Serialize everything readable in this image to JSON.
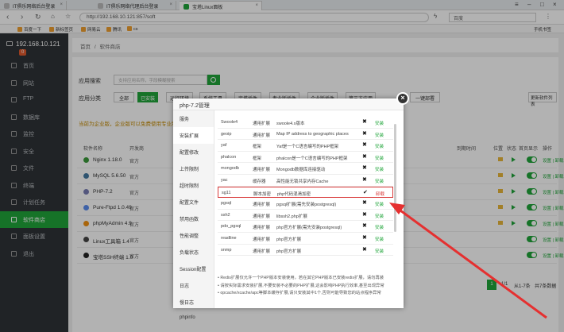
{
  "browser": {
    "tabs": [
      {
        "label": "IT俱乐网络后台登录"
      },
      {
        "label": "IT俱乐网络代理后台登录"
      },
      {
        "label": "宝塔Linux面板"
      }
    ],
    "url": "http://192.168.10.121:857/soft",
    "search_placeholder": "百度",
    "bookmarks": [
      "百度一下",
      "新标签页",
      "网易云",
      "腾讯",
      "cs"
    ],
    "bookmarks_right": "手机书签"
  },
  "sidebar": {
    "host": "192.168.10.121",
    "badge": "0",
    "items": [
      {
        "label": "首页"
      },
      {
        "label": "网站"
      },
      {
        "label": "FTP"
      },
      {
        "label": "数据库"
      },
      {
        "label": "监控"
      },
      {
        "label": "安全"
      },
      {
        "label": "文件"
      },
      {
        "label": "终端"
      },
      {
        "label": "计划任务"
      },
      {
        "label": "软件商店"
      },
      {
        "label": "面板设置"
      },
      {
        "label": "退出"
      }
    ]
  },
  "breadcrumb": {
    "home": "首页",
    "sep": "/",
    "current": "软件商店"
  },
  "store": {
    "search_label": "应用搜索",
    "search_placeholder": "支持应用名称，字段模糊搜索",
    "category_label": "应用分类",
    "categories": [
      "全部",
      "已安装",
      "运行环境",
      "系统工具",
      "宝塔插件",
      "专业版插件",
      "企业版插件",
      "第三方应用",
      "一键部署"
    ],
    "update_button": "更新软件列表",
    "notice": "当前为企业版，企业版可以免费使用专业版插件",
    "headers": [
      "软件名称",
      "开发商",
      "到期时间",
      "位置",
      "状态",
      "首页显示",
      "操作"
    ],
    "modules": [
      {
        "name": "Nginx 1.18.0",
        "dev": "官方",
        "actions": "设置 | 卸载"
      },
      {
        "name": "MySQL 5.6.50",
        "dev": "官方",
        "actions": "设置 | 卸载"
      },
      {
        "name": "PHP-7.2",
        "dev": "官方",
        "actions": "设置 | 卸载"
      },
      {
        "name": "Pure-Ftpd 1.0.49",
        "dev": "官方",
        "actions": "设置 | 卸载"
      },
      {
        "name": "phpMyAdmin 4.9",
        "dev": "官方",
        "actions": "设置 | 卸载"
      },
      {
        "name": "Linux工具箱 1.4",
        "dev": "官方",
        "actions": "设置 | 卸载"
      },
      {
        "name": "宝塔SSH终端 1.0",
        "dev": "官方",
        "actions": "设置 | 卸载"
      }
    ],
    "pager": {
      "page": "1",
      "total_pages": "1/1",
      "range": "从1-7条",
      "total": "共7条数据"
    }
  },
  "modal": {
    "title": "php-7.2管理",
    "nav": [
      "服务",
      "安装扩展",
      "配置修改",
      "上传限制",
      "超时限制",
      "配置文件",
      "禁用函数",
      "性能调整",
      "负载状态",
      "Session配置",
      "日志",
      "慢日志",
      "phpinfo"
    ],
    "active_nav": "安装扩展",
    "extensions": [
      {
        "name": "Swoole4",
        "type": "通用扩展",
        "desc": "swoole4.x版本",
        "status": "✖",
        "action": "安装"
      },
      {
        "name": "geoip",
        "type": "通用扩展",
        "desc": "Map IP address to geographic places",
        "status": "✖",
        "action": "安装"
      },
      {
        "name": "yaf",
        "type": "框架",
        "desc": "Yaf是一个C语言编写的PHP框架",
        "status": "✖",
        "action": "安装"
      },
      {
        "name": "phalcon",
        "type": "框架",
        "desc": "phalcon是一个C语言编写的PHP框架",
        "status": "✖",
        "action": "安装"
      },
      {
        "name": "mongodb",
        "type": "通用扩展",
        "desc": "Mongodb数据库连接驱动",
        "status": "✖",
        "action": "安装"
      },
      {
        "name": "yac",
        "type": "缓存器",
        "desc": "高性能无锁共享内存Cache",
        "status": "✖",
        "action": "安装"
      },
      {
        "name": "sg11",
        "type": "脚本加密",
        "desc": "php代码混淆加密",
        "status": "✔",
        "action": "卸载"
      },
      {
        "name": "pgsql",
        "type": "通用扩展",
        "desc": "pgsql扩展(需先安装postgresql)",
        "status": "✖",
        "action": "安装"
      },
      {
        "name": "ssh2",
        "type": "通用扩展",
        "desc": "libssh2.php扩展",
        "status": "✖",
        "action": "安装"
      },
      {
        "name": "pdo_pgsql",
        "type": "通用扩展",
        "desc": "php官方扩展(需先安装postgresql)",
        "status": "✖",
        "action": "安装"
      },
      {
        "name": "readline",
        "type": "通用扩展",
        "desc": "php官方扩展",
        "status": "✖",
        "action": "安装"
      },
      {
        "name": "snmp",
        "type": "通用扩展",
        "desc": "php官方扩展",
        "status": "✖",
        "action": "安装"
      }
    ],
    "notes": [
      "Redis扩展仅允许一个PHP版本安装使用，若在其它PHP版本已安装redis扩展，请勿再装",
      "请按实际需求安装扩展,不要安装不必要的PHP扩展,这会影响PHP执行效率,甚至出现异常",
      "opcache/xcache/apc等脚本缓存扩展,请只安装其中1个,否则可能导致您的站点程序异常"
    ]
  },
  "colors": {
    "accent": "#20a53a",
    "highlight": "#d93a3a",
    "sidebar": "#2f3337"
  }
}
